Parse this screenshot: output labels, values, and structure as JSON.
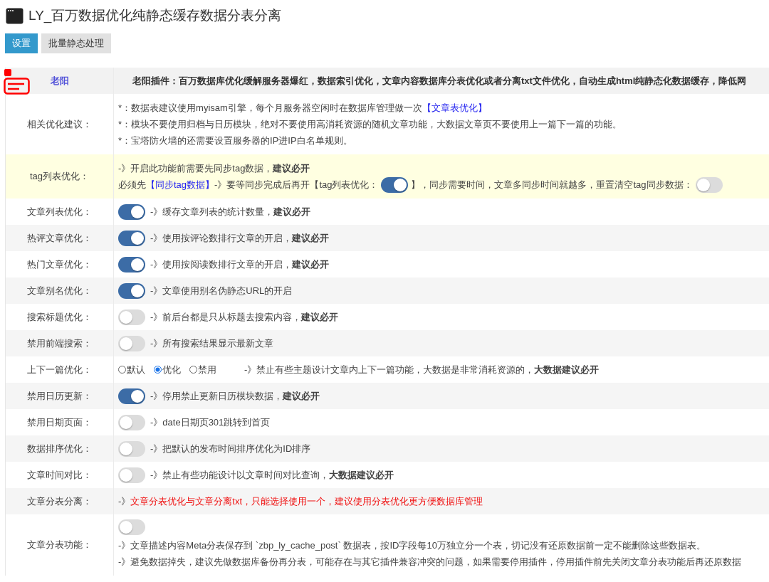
{
  "title": "LY_百万数据优化纯静态缓存数据分表分离",
  "tabs": [
    {
      "label": "设置",
      "selected": true
    },
    {
      "label": "批量静态处理",
      "selected": false
    }
  ],
  "header": {
    "author": "老阳",
    "description": "老阳插件：百万数据库优化缓解服务器爆红，数据索引优化，文章内容数据库分表优化或者分离txt文件优化，自动生成html纯静态化数据缓存，降低网"
  },
  "rows": [
    {
      "kind": "notes",
      "label": "相关优化建议：",
      "lines": [
        [
          {
            "kind": "text",
            "text": "*：数据表建议使用myisam引擎，每个月服务器空闲时在数据库管理做一次"
          },
          {
            "kind": "link",
            "text": "【文章表优化】"
          }
        ],
        [
          {
            "kind": "text",
            "text": "*：模块不要使用归档与日历模块，绝对不要使用高消耗资源的随机文章功能，大数据文章页不要使用上一篇下一篇的功能。"
          }
        ],
        [
          {
            "kind": "text",
            "text": "*：宝塔防火墙的还需要设置服务器的IP进IP白名单规则。"
          }
        ]
      ]
    },
    {
      "kind": "notice",
      "label": "tag列表优化：",
      "lines": [
        [
          {
            "kind": "text",
            "text": "-》开启此功能前需要先同步tag数据，**建议必开**"
          }
        ],
        [
          {
            "kind": "text",
            "text": "必须先"
          },
          {
            "kind": "link",
            "text": "【同步tag数据】"
          },
          {
            "kind": "text",
            "text": "-》要等同步完成后再开【tag列表优化："
          },
          {
            "kind": "toggle",
            "on": true
          },
          {
            "kind": "text",
            "text": "】，同步需要时间，文章多同步时间就越多，重置清空tag同步数据："
          },
          {
            "kind": "toggle",
            "on": false
          }
        ]
      ]
    },
    {
      "kind": "toggle",
      "label": "文章列表优化：",
      "on": true,
      "description": "-》缓存文章列表的统计数量，**建议必开**"
    },
    {
      "kind": "toggle",
      "label": "热评文章优化：",
      "on": true,
      "description": "-》使用按评论数排行文章的开启，**建议必开**"
    },
    {
      "kind": "toggle",
      "label": "热门文章优化：",
      "on": true,
      "description": "-》使用按阅读数排行文章的开启，**建议必开**"
    },
    {
      "kind": "toggle",
      "label": "文章别名优化：",
      "on": true,
      "description": "-》文章使用别名伪静态URL的开启"
    },
    {
      "kind": "toggle",
      "label": "搜索标题优化：",
      "on": false,
      "description": "-》前后台都是只从标题去搜索内容，**建议必开**"
    },
    {
      "kind": "toggle",
      "label": "禁用前端搜索：",
      "on": false,
      "description": "-》所有搜索结果显示最新文章"
    },
    {
      "kind": "radio",
      "label": "上下一篇优化：",
      "options": [
        {
          "label": "默认",
          "selected": false
        },
        {
          "label": "优化",
          "selected": true
        },
        {
          "label": "禁用",
          "selected": false
        }
      ],
      "description": "-》禁止有些主题设计文章内上下一篇功能，大数据是非常消耗资源的，**大数据建议必开**"
    },
    {
      "kind": "toggle",
      "label": "禁用日历更新：",
      "on": true,
      "description": "-》停用禁止更新日历模块数据，**建议必开**"
    },
    {
      "kind": "toggle",
      "label": "禁用日期页面：",
      "on": false,
      "description": "-》date日期页301跳转到首页"
    },
    {
      "kind": "toggle",
      "label": "数据排序优化：",
      "on": false,
      "description": "-》把默认的发布时间排序优化为ID排序"
    },
    {
      "kind": "toggle",
      "label": "文章时间对比：",
      "on": false,
      "description": "-》禁止有些功能设计以文章时间对比查询，**大数据建议必开**"
    },
    {
      "kind": "alert",
      "label": "文章分表分离：",
      "lead": "-》",
      "text": "文章分表优化与文章分离txt，只能选择使用一个，建议使用分表优化更方便数据库管理"
    },
    {
      "kind": "toggle_block",
      "label": "文章分表功能：",
      "on": false,
      "lines": [
        "-》文章描述内容Meta分表保存到 `zbp_ly_cache_post` 数据表，按ID字段每10万独立分一个表，切记没有还原数据前一定不能删除这些数据表。",
        "-》避免数据掉失，建议先做数据库备份再分表，可能存在与其它插件兼容冲突的问题，如果需要停用插件，停用插件前先关闭文章分表功能后再还原数据"
      ]
    }
  ]
}
